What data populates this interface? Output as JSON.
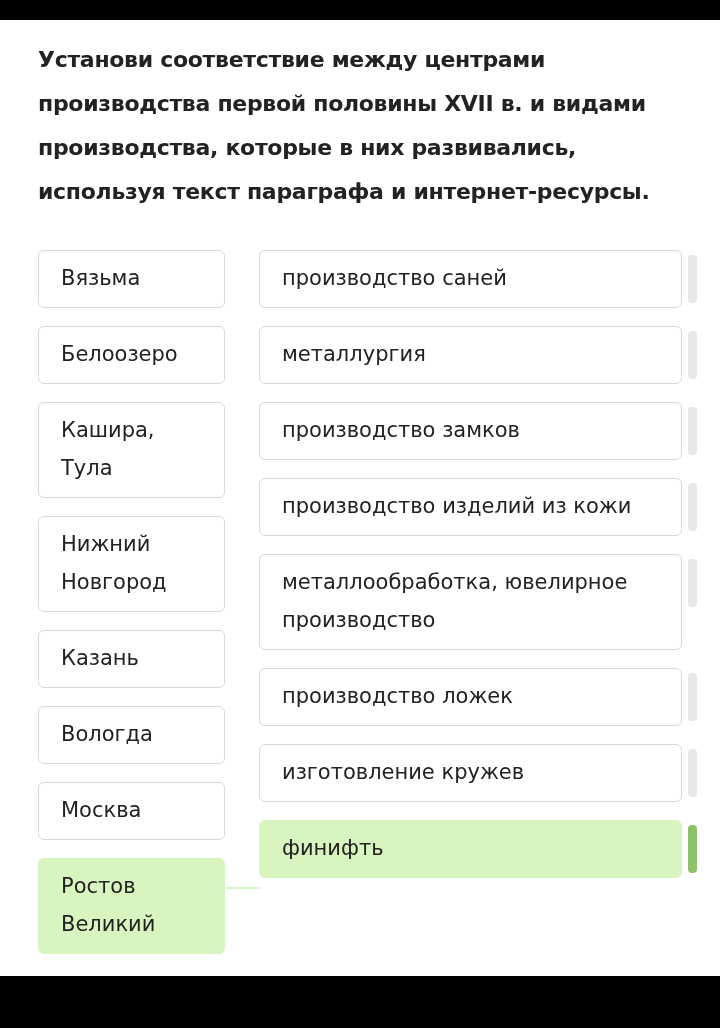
{
  "task": {
    "text": "Установи соответствие между центрами производства первой половины XVII в. и видами производства, которые в них развивались, используя текст параграфа и интернет-ресурсы."
  },
  "pairs": [
    {
      "left": "Вязьма",
      "right": "производство саней",
      "matched": false
    },
    {
      "left": "Белоозеро",
      "right": "металлургия",
      "matched": false
    },
    {
      "left": "Кашира, Тула",
      "right": "производство замков",
      "matched": false
    },
    {
      "left": "Нижний Новгород",
      "right": "производство изделий из кожи",
      "matched": false
    },
    {
      "left": "Казань",
      "right": "металлообработка, ювелирное производство",
      "matched": false
    },
    {
      "left": "Вологда",
      "right": "производство ложек",
      "matched": false
    },
    {
      "left": "Москва",
      "right": "изготовление кружев",
      "matched": false
    },
    {
      "left": "Ростов Великий",
      "right": "финифть",
      "matched": true
    }
  ]
}
